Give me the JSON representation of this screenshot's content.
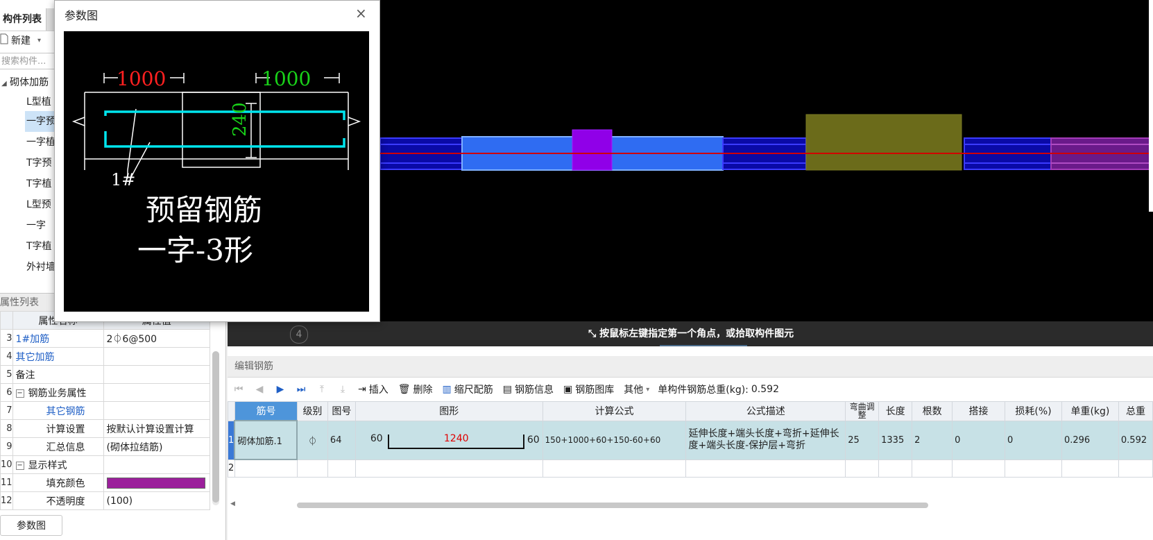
{
  "left_panel": {
    "tab_label": "构件列表",
    "new_button": "新建",
    "new_caret": "▾",
    "search_placeholder": "搜索构件...",
    "tree_root": "砌体加筋",
    "tree_items": [
      "L型植",
      "一字预",
      "一字植",
      "T字预",
      "T字植",
      "L型预",
      "一字",
      "T字植",
      "外衬墙"
    ],
    "selected_index": 1
  },
  "property_panel": {
    "header": "属性列表",
    "col_name": "属性名称",
    "col_value": "属性值",
    "rows": [
      {
        "num": "3",
        "name": "1#加筋",
        "value": "2⏀6@500",
        "style": "blue"
      },
      {
        "num": "4",
        "name": "其它加筋",
        "value": "",
        "style": "blue"
      },
      {
        "num": "5",
        "name": "备注",
        "value": "",
        "style": "plain"
      },
      {
        "num": "6",
        "name": "钢筋业务属性",
        "value": "",
        "style": "group"
      },
      {
        "num": "7",
        "name": "其它钢筋",
        "value": "",
        "style": "child-blue"
      },
      {
        "num": "8",
        "name": "计算设置",
        "value": "按默认计算设置计算",
        "style": "child"
      },
      {
        "num": "9",
        "name": "汇总信息",
        "value": "(砌体拉结筋)",
        "style": "child"
      },
      {
        "num": "10",
        "name": "显示样式",
        "value": "",
        "style": "group"
      },
      {
        "num": "11",
        "name": "填充颜色",
        "value": "",
        "style": "color"
      },
      {
        "num": "12",
        "name": "不透明度",
        "value": "(100)",
        "style": "child"
      }
    ],
    "fill_color": "#9b1f9b",
    "bottom_tab": "参数图"
  },
  "dialog": {
    "title": "参数图",
    "close_icon": "×",
    "drawing": {
      "left_dim": "1000",
      "right_dim": "1000",
      "height_dim": "240",
      "bar_label": "1#",
      "caption_line1": "预留钢筋",
      "caption_line2": "一字-3形"
    },
    "colors": {
      "left_dim": "#ff2020",
      "right_dim": "#19d219",
      "bar": "#00e5ee"
    }
  },
  "viewport": {
    "status_text": "按鼠标左键指定第一个角点，或拾取构件图元",
    "coord_marker": "4",
    "colors": {
      "wall": "#1a1aff",
      "selected": "#3d7cff",
      "column": "#8a00e6",
      "block": "#6b6b1a",
      "axis": "#cc0000",
      "magenta": "#9b1f9b"
    }
  },
  "editor": {
    "header": "编辑钢筋",
    "toolbar": {
      "nav": [
        "⏮",
        "◀",
        "▶",
        "⏭",
        "⤒",
        "⤓"
      ],
      "insert": "插入",
      "delete": "删除",
      "scale": "缩尺配筋",
      "info": "钢筋信息",
      "library": "钢筋图库",
      "other": "其他",
      "other_caret": "▾",
      "total_label": "单构件钢筋总重(kg):",
      "total_value": "0.592"
    },
    "columns": [
      "筋号",
      "级别",
      "图号",
      "图形",
      "计算公式",
      "公式描述",
      "弯曲调整",
      "长度",
      "根数",
      "搭接",
      "损耗(%)",
      "单重(kg)",
      "总重"
    ],
    "rows": [
      {
        "num": "1",
        "name": "砌体加筋.1",
        "grade": "⏀",
        "fig": "64",
        "shape_left": "60",
        "shape_mid": "1240",
        "shape_right": "60",
        "formula": "150+1000+60+150-60+60",
        "desc": "延伸长度+端头长度+弯折+延伸长度+端头长度-保护层+弯折",
        "bend": "25",
        "length": "1335",
        "count": "2",
        "lap": "0",
        "loss": "0",
        "unit_weight": "0.296",
        "total_weight": "0.592"
      }
    ],
    "empty_row_num": "2"
  }
}
